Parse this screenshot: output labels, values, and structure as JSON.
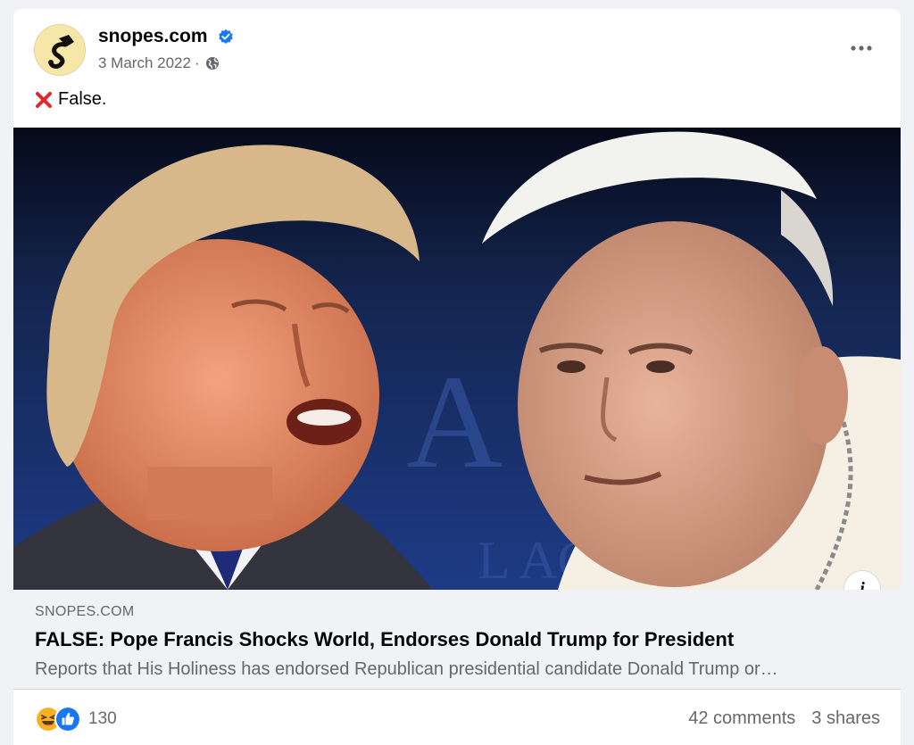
{
  "post": {
    "page_name": "snopes.com",
    "date": "3 March 2022",
    "separator": "·",
    "privacy_icon": "globe-icon",
    "verified_icon": "verified-badge-icon",
    "more_icon": "more-options-icon",
    "caption_icon": "cross-mark-icon",
    "caption": "False."
  },
  "link_preview": {
    "domain": "SNOPES.COM",
    "title": "FALSE: Pope Francis Shocks World, Endorses Donald Trump for President",
    "description": "Reports that His Holiness has endorsed Republican presidential candidate Donald Trump or…",
    "info_icon": "i"
  },
  "engagement": {
    "reaction_icons": [
      "haha-icon",
      "like-icon"
    ],
    "reaction_count": "130",
    "comments": "42 comments",
    "shares": "3 shares"
  },
  "colors": {
    "accent": "#1877f2",
    "secondary_text": "#65676b",
    "background": "#f0f2f5"
  }
}
